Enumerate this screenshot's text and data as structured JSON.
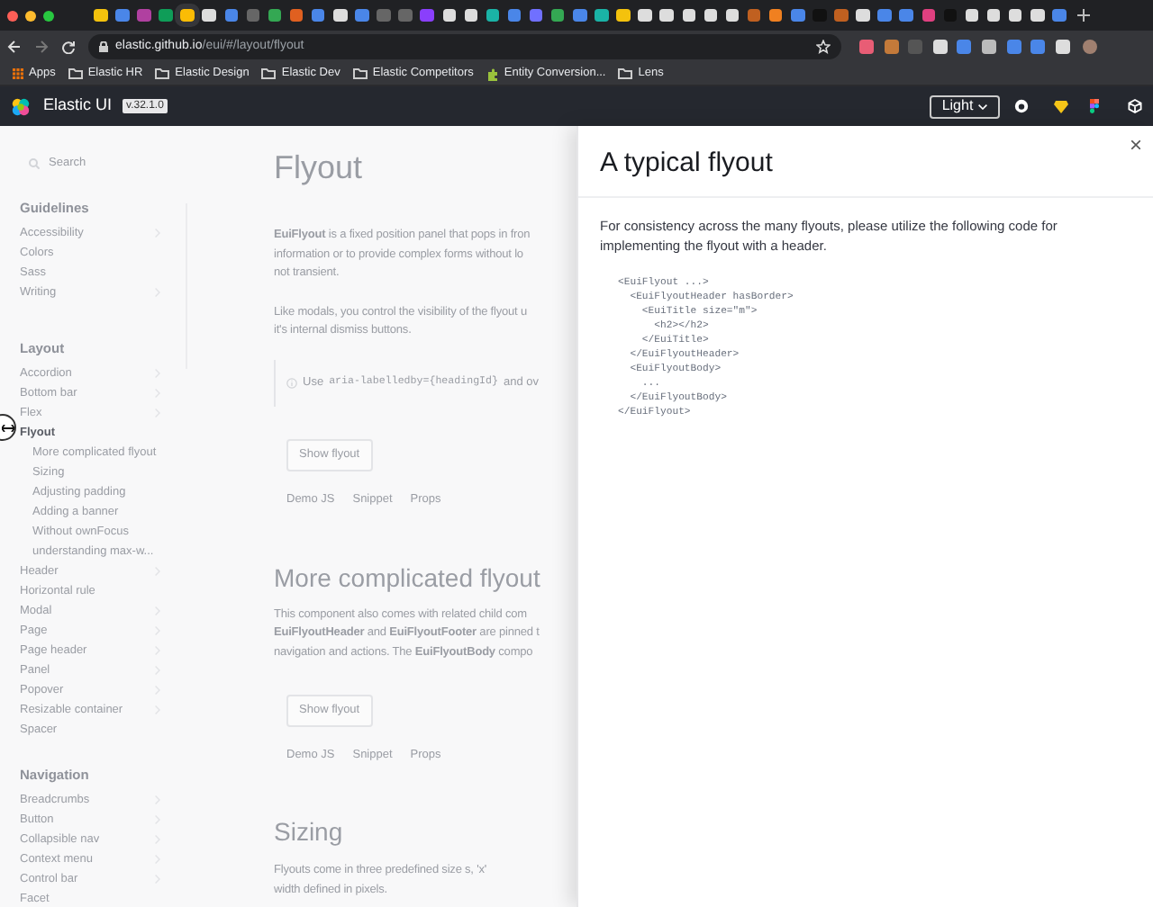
{
  "browser": {
    "url_host": "elastic.github.io",
    "url_path": "/eui/#/layout/flyout",
    "bookmarks": [
      {
        "kind": "apps",
        "label": "Apps"
      },
      {
        "kind": "folder",
        "label": "Elastic HR"
      },
      {
        "kind": "folder",
        "label": "Elastic Design"
      },
      {
        "kind": "folder",
        "label": "Elastic Dev"
      },
      {
        "kind": "folder",
        "label": "Elastic Competitors"
      },
      {
        "kind": "page",
        "label": "Entity Conversion..."
      },
      {
        "kind": "folder",
        "label": "Lens"
      }
    ]
  },
  "header": {
    "title": "Elastic UI",
    "version": "v.32.1.0",
    "theme_button": "Light"
  },
  "sidebar": {
    "search": {
      "placeholder": "Search"
    },
    "sections": [
      {
        "title": "Guidelines",
        "items": [
          {
            "label": "Accessibility",
            "expandable": true,
            "selected": false
          },
          {
            "label": "Colors",
            "expandable": false,
            "selected": false
          },
          {
            "label": "Sass",
            "expandable": false,
            "selected": false
          },
          {
            "label": "Writing",
            "expandable": true,
            "selected": false
          }
        ]
      },
      {
        "title": "Layout",
        "items": [
          {
            "label": "Accordion",
            "expandable": true,
            "selected": false
          },
          {
            "label": "Bottom bar",
            "expandable": true,
            "selected": false
          },
          {
            "label": "Flex",
            "expandable": true,
            "selected": false
          },
          {
            "label": "Flyout",
            "expandable": false,
            "selected": true,
            "children": [
              {
                "label": "More complicated flyout",
                "selected": false
              },
              {
                "label": "Sizing",
                "selected": false
              },
              {
                "label": "Adjusting padding",
                "selected": false
              },
              {
                "label": "Adding a banner",
                "selected": false
              },
              {
                "label": "Without ownFocus",
                "selected": false
              },
              {
                "label": "understanding max-w...",
                "selected": false
              }
            ]
          },
          {
            "label": "Header",
            "expandable": true,
            "selected": false
          },
          {
            "label": "Horizontal rule",
            "expandable": false,
            "selected": false
          },
          {
            "label": "Modal",
            "expandable": true,
            "selected": false
          },
          {
            "label": "Page",
            "expandable": true,
            "selected": false
          },
          {
            "label": "Page header",
            "expandable": true,
            "selected": false
          },
          {
            "label": "Panel",
            "expandable": true,
            "selected": false
          },
          {
            "label": "Popover",
            "expandable": true,
            "selected": false
          },
          {
            "label": "Resizable container",
            "expandable": true,
            "selected": false
          },
          {
            "label": "Spacer",
            "expandable": false,
            "selected": false
          }
        ]
      },
      {
        "title": "Navigation",
        "items": [
          {
            "label": "Breadcrumbs",
            "expandable": true,
            "selected": false
          },
          {
            "label": "Button",
            "expandable": true,
            "selected": false
          },
          {
            "label": "Collapsible nav",
            "expandable": true,
            "selected": false
          },
          {
            "label": "Context menu",
            "expandable": true,
            "selected": false
          },
          {
            "label": "Control bar",
            "expandable": true,
            "selected": false
          },
          {
            "label": "Facet",
            "expandable": false,
            "selected": false
          }
        ]
      }
    ]
  },
  "content": {
    "title": "Flyout",
    "intro_lines": [
      "**EuiFlyout** is a fixed position panel that pops in fron",
      "information or to provide complex forms without lo",
      "not transient."
    ],
    "modal_lines": [
      "Like modals, you control the visibility of the flyout u",
      "it's internal dismiss buttons."
    ],
    "callout": {
      "prefix": "Use",
      "code": "aria-labelledby={headingId}",
      "suffix": "and ov"
    },
    "sections": [
      {
        "button": "Show flyout",
        "tabs": [
          "Demo JS",
          "Snippet",
          "Props"
        ]
      },
      {
        "title": "More complicated flyout",
        "lines": [
          "This component also comes with related child com",
          "**EuiFlyoutHeader** and **EuiFlyoutFooter** are pinned t",
          "navigation and actions. The **EuiFlyoutBody** compo"
        ],
        "button": "Show flyout",
        "tabs": [
          "Demo JS",
          "Snippet",
          "Props"
        ]
      },
      {
        "title": "Sizing",
        "lines": [
          "Flyouts come in three predefined  size s,  'x'",
          "width defined in pixels."
        ]
      }
    ]
  },
  "flyout": {
    "title": "A typical flyout",
    "text": "For consistency across the many flyouts, please utilize the following code for implementing the flyout with a header.",
    "code": [
      "<EuiFlyout ...>",
      "  <EuiFlyoutHeader hasBorder>",
      "    <EuiTitle size=\"m\">",
      "      <h2></h2>",
      "    </EuiTitle>",
      "  </EuiFlyoutHeader>",
      "  <EuiFlyoutBody>",
      "    ...",
      "  </EuiFlyoutBody>",
      "</EuiFlyout>"
    ]
  }
}
